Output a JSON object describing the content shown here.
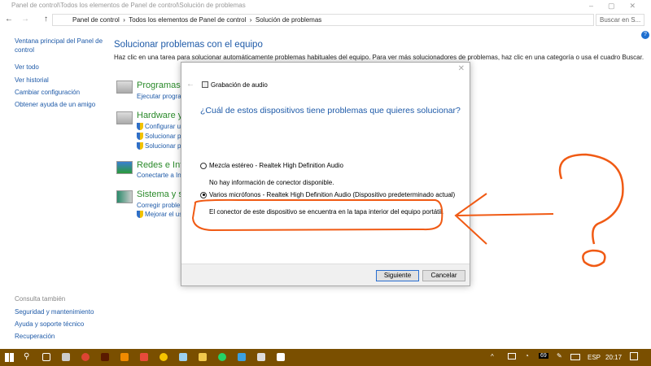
{
  "window": {
    "title": "Panel de control\\Todos los elementos de Panel de control\\Solución de problemas"
  },
  "address": {
    "crumbs": [
      "Panel de control",
      "Todos los elementos de Panel de control",
      "Solución de problemas"
    ],
    "search_placeholder": "Buscar en S..."
  },
  "sidebar": {
    "items": [
      "Ventana principal del Panel de control",
      "Ver todo",
      "Ver historial",
      "Cambiar configuración",
      "Obtener ayuda de un amigo"
    ],
    "see_also": "Consulta también",
    "see_also_items": [
      "Seguridad y mantenimiento",
      "Ayuda y soporte técnico",
      "Recuperación"
    ]
  },
  "main": {
    "title": "Solucionar problemas con el equipo",
    "description": "Haz clic en una tarea para solucionar automáticamente problemas habituales del equipo. Para ver más solucionadores de problemas, haz clic en una categoría o usa el cuadro Buscar.",
    "categories": [
      {
        "title": "Programas",
        "links": [
          "Ejecutar program"
        ]
      },
      {
        "title": "Hardware y s",
        "links": [
          "Configurar u",
          "Solucionar pr",
          "Solucionar pr"
        ]
      },
      {
        "title": "Redes e Inte",
        "links": [
          "Conectarte a Inte"
        ]
      },
      {
        "title": "Sistema y se",
        "links": [
          "Corregir problen",
          "Mejorar el us"
        ]
      }
    ]
  },
  "dialog": {
    "title": "Grabación de audio",
    "question": "¿Cuál de estos dispositivos tiene problemas que quieres solucionar?",
    "options": [
      {
        "label": "Mezcla estéreo - Realtek High Definition Audio",
        "detail": "No hay información de conector disponible.",
        "selected": false
      },
      {
        "label": "Varios micrófonos - Realtek High Definition Audio (Dispositivo predeterminado actual)",
        "detail": "El conector de este dispositivo se encuentra en la tapa interior del equipo portátil.",
        "selected": true
      }
    ],
    "next": "Siguiente",
    "cancel": "Cancelar"
  },
  "annotation": {
    "color": "#f05a14"
  },
  "taskbar": {
    "lang": "ESP",
    "time": "20:17",
    "badge": "69",
    "color": "#7a4f00"
  }
}
